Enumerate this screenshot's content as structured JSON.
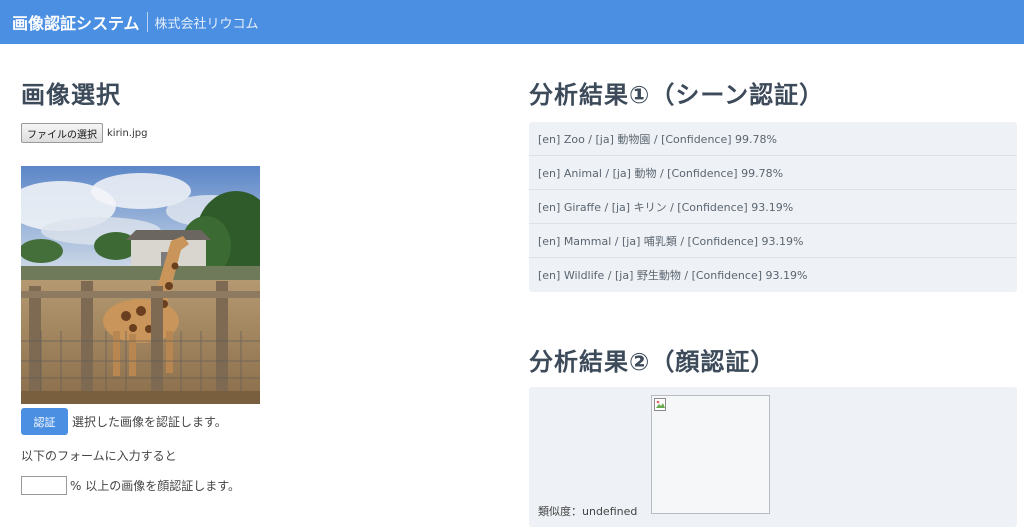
{
  "header": {
    "title": "画像認証システム",
    "company": "株式会社リウコム",
    "bg_color": "#4b8fe2"
  },
  "left": {
    "title": "画像選択",
    "file_button_label": "ファイルの選択",
    "file_name": "kirin.jpg",
    "auth_button_label": "認証",
    "auth_text": "選択した画像を認証します。",
    "form_hint": "以下のフォームに入力すると",
    "pct_input_value": "",
    "pct_suffix": "% 以上の画像を顔認証します。"
  },
  "right": {
    "scene_title": "分析結果①（シーン認証）",
    "scene_results": [
      "[en] Zoo / [ja] 動物園 / [Confidence] 99.78%",
      "[en] Animal / [ja] 動物 / [Confidence] 99.78%",
      "[en] Giraffe / [ja] キリン / [Confidence] 93.19%",
      "[en] Mammal / [ja] 哺乳類 / [Confidence] 93.19%",
      "[en] Wildlife / [ja] 野生動物 / [Confidence] 93.19%"
    ],
    "face_title": "分析結果②（顔認証）",
    "similarity_text": "類似度：undefined",
    "broken_image_icon": "broken-image-icon"
  }
}
